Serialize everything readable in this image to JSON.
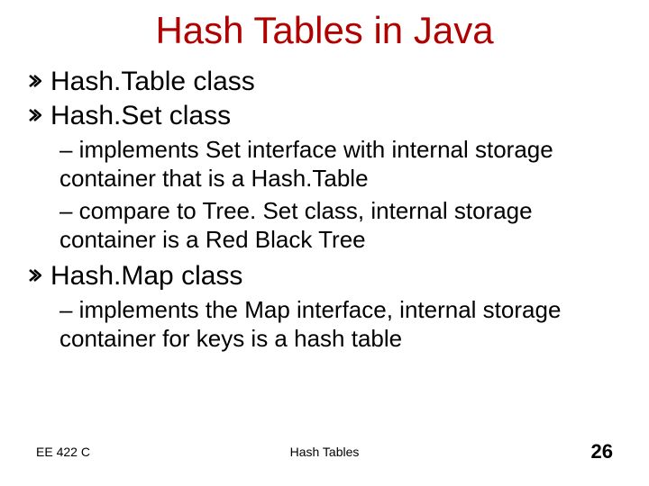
{
  "title": "Hash Tables in Java",
  "items": [
    {
      "text": "Hash.Table class",
      "sub": []
    },
    {
      "text": "Hash.Set class",
      "sub": [
        "– implements Set interface with internal storage container that is a Hash.Table",
        "– compare to Tree. Set class, internal storage container is a Red Black Tree"
      ]
    },
    {
      "text": "Hash.Map class",
      "sub": [
        "– implements the Map interface, internal storage container for keys is a hash table"
      ]
    }
  ],
  "footer": {
    "left": "EE 422 C",
    "center": "Hash Tables",
    "right": "26"
  }
}
